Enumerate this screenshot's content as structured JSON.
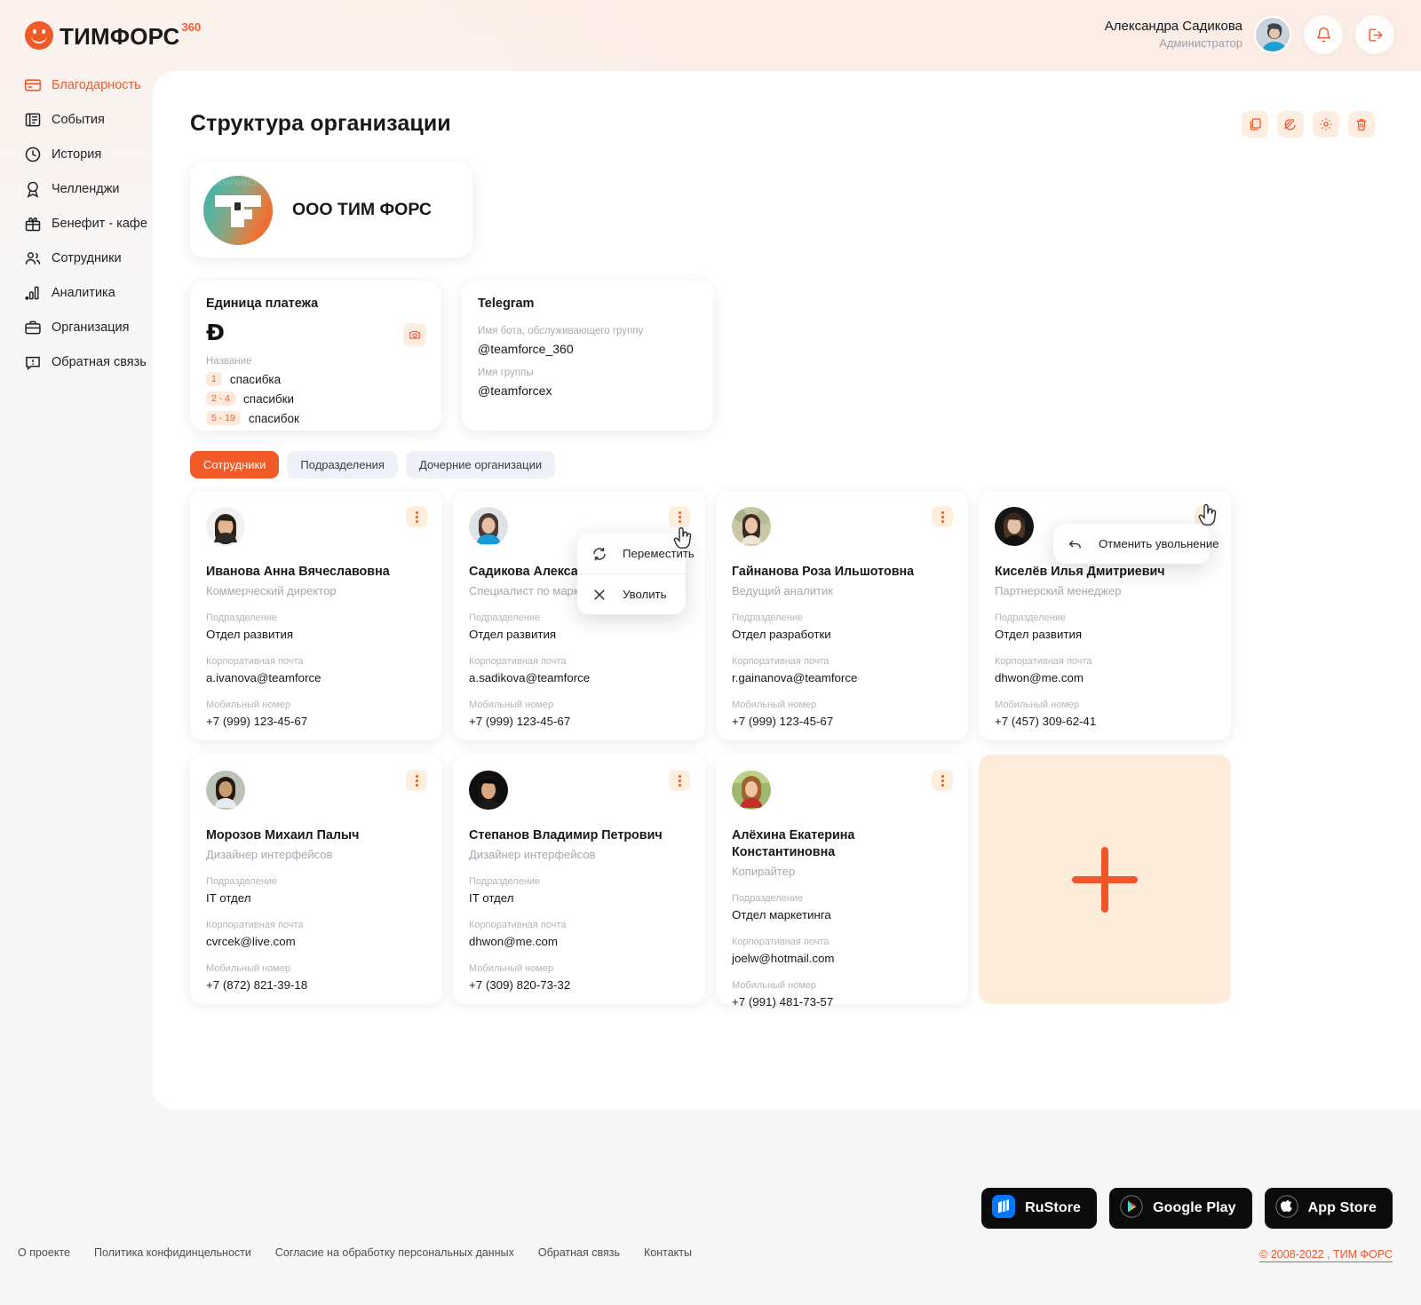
{
  "brand": {
    "name": "ТИМФОРС",
    "sup": "360",
    "logo_icon": "teamforce-logo-icon",
    "accent": "#f05a28"
  },
  "header": {
    "user_name": "Александра Садикова",
    "user_role": "Администратор",
    "avatar_icon": "user-avatar",
    "bell_icon": "bell-icon",
    "logout_icon": "logout-icon"
  },
  "sidebar": {
    "items": [
      {
        "label": "Благодарность",
        "icon": "card-icon",
        "active": true
      },
      {
        "label": "События",
        "icon": "news-icon",
        "active": false
      },
      {
        "label": "История",
        "icon": "clock-icon",
        "active": false
      },
      {
        "label": "Челленджи",
        "icon": "medal-icon",
        "active": false
      },
      {
        "label": "Бенефит - кафе",
        "icon": "gift-icon",
        "active": false
      },
      {
        "label": "Сотрудники",
        "icon": "users-icon",
        "active": false
      },
      {
        "label": "Аналитика",
        "icon": "bar-chart-icon",
        "active": false
      },
      {
        "label": "Организация",
        "icon": "briefcase-icon",
        "active": false
      },
      {
        "label": "Обратная связь",
        "icon": "chat-alert-icon",
        "active": false
      }
    ]
  },
  "main": {
    "title": "Структура организации",
    "title_actions": [
      {
        "name": "copy-button",
        "icon": "copy-icon"
      },
      {
        "name": "edit-button",
        "icon": "pencil-circle-icon"
      },
      {
        "name": "settings-button",
        "icon": "gear-icon"
      },
      {
        "name": "delete-button",
        "icon": "trash-icon"
      }
    ],
    "organization": {
      "name": "ООО ТИМ ФОРС",
      "logo_icon": "org-logo-icon",
      "logo_watermark": "TEAMFORCE"
    },
    "payment_unit": {
      "title": "Единица платежа",
      "coin_icon": "thanks-coin-icon",
      "camera_icon": "camera-icon",
      "name_label": "Название",
      "forms": [
        {
          "range": "1",
          "word": "спасибка"
        },
        {
          "range": "2 - 4",
          "word": "спасибки"
        },
        {
          "range": "5 - 19",
          "word": "спасибок"
        }
      ]
    },
    "telegram": {
      "title": "Telegram",
      "bot_label": "Имя бота, обслуживающего группу",
      "bot_value": "@teamforce_360",
      "group_label": "Имя группы",
      "group_value": "@teamforcex"
    },
    "tabs": [
      {
        "label": "Сотрудники",
        "active": true
      },
      {
        "label": "Подразделения",
        "active": false
      },
      {
        "label": "Дочерние организации",
        "active": false
      }
    ],
    "field_labels": {
      "department": "Подразделение",
      "email": "Корпоративная почта",
      "phone": "Мобильный номер"
    },
    "employees": [
      {
        "name": "Иванова Анна Вячеславовна",
        "position": "Коммерческий директор",
        "department": "Отдел развития",
        "email": "a.ivanova@teamforce",
        "phone": "+7 (999) 123-45-67",
        "avatar_icon": "avatar-ivanova"
      },
      {
        "name": "Садикова Александра Сергеевна",
        "position": "Специалист по маркетингу",
        "department": "Отдел развития",
        "email": "a.sadikova@teamforce",
        "phone": "+7 (999) 123-45-67",
        "avatar_icon": "avatar-sadikova"
      },
      {
        "name": "Гайнанова Роза Ильшотовна",
        "position": "Ведущий аналитик",
        "department": "Отдел разработки",
        "email": "r.gainanova@teamforce",
        "phone": "+7 (999) 123-45-67",
        "avatar_icon": "avatar-gainanova"
      },
      {
        "name": "Киселёв Илья Дмитриевич",
        "position": "Партнерский менеджер",
        "department": "Отдел развития",
        "email": "dhwon@me.com",
        "phone": "+7 (457) 309-62-41",
        "avatar_icon": "avatar-kiselev"
      },
      {
        "name": "Морозов Михаил Палыч",
        "position": "Дизайнер интерфейсов",
        "department": "IT отдел",
        "email": "cvrcek@live.com",
        "phone": "+7 (872) 821-39-18",
        "avatar_icon": "avatar-morozov"
      },
      {
        "name": "Степанов Владимир Петрович",
        "position": "Дизайнер интерфейсов",
        "department": "IT отдел",
        "email": "dhwon@me.com",
        "phone": "+7 (309) 820-73-32",
        "avatar_icon": "avatar-stepanov"
      },
      {
        "name": "Алёхина Екатерина Константиновна",
        "position": "Копирайтер",
        "department": "Отдел маркетинга",
        "email": "joelw@hotmail.com",
        "phone": "+7 (991) 481-73-57",
        "avatar_icon": "avatar-alekhina"
      }
    ],
    "add_employee_icon": "plus-icon"
  },
  "menus": {
    "card_menu": [
      {
        "label": "Переместить",
        "icon": "move-icon"
      },
      {
        "label": "Уволить",
        "icon": "close-x-icon"
      }
    ],
    "undo_menu": [
      {
        "label": "Отменить увольнение",
        "icon": "undo-arrow-icon"
      }
    ]
  },
  "footer": {
    "links": [
      "О проекте",
      "Политика конфидинцельности",
      "Согласие на обработку персональных данных",
      "Обратная связь",
      "Контакты"
    ],
    "stores": [
      {
        "label": "RuStore",
        "icon": "rustore-icon"
      },
      {
        "label": "Google Play",
        "icon": "google-play-icon"
      },
      {
        "label": "App Store",
        "icon": "apple-icon"
      }
    ],
    "copyright": "© 2008-2022 , ТИМ ФОРС"
  }
}
